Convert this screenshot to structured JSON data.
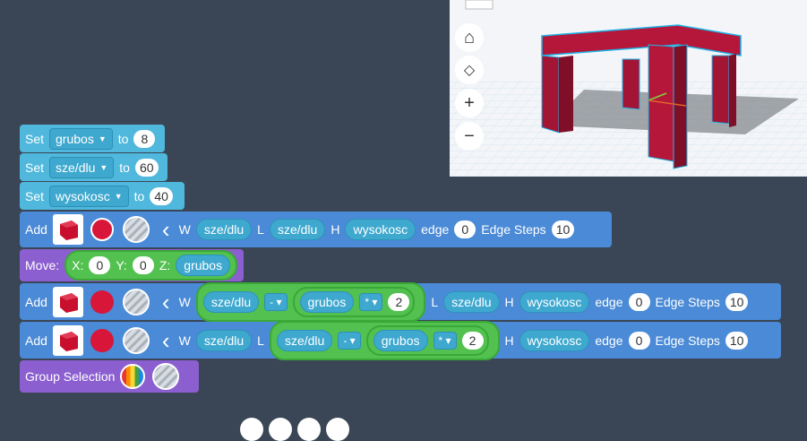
{
  "blocks": {
    "set1": {
      "set": "Set",
      "var": "grubos",
      "to": "to",
      "val": "8"
    },
    "set2": {
      "set": "Set",
      "var": "sze/dlu",
      "to": "to",
      "val": "60"
    },
    "set3": {
      "set": "Set",
      "var": "wysokosc",
      "to": "to",
      "val": "40"
    },
    "add1": {
      "add": "Add",
      "w": "W",
      "wv": "sze/dlu",
      "l": "L",
      "lv": "sze/dlu",
      "h": "H",
      "hv": "wysokosc",
      "edge": "edge",
      "ev": "0",
      "steps": "Edge Steps",
      "sv": "10"
    },
    "move": {
      "label": "Move:",
      "x": "X:",
      "xv": "0",
      "y": "Y:",
      "yv": "0",
      "z": "Z:",
      "zv": "grubos"
    },
    "add2": {
      "add": "Add",
      "w": "W",
      "a": "sze/dlu",
      "op1": "- ▾",
      "b": "grubos",
      "op2": "* ▾",
      "c": "2",
      "l": "L",
      "lv": "sze/dlu",
      "h": "H",
      "hv": "wysokosc",
      "edge": "edge",
      "ev": "0",
      "steps": "Edge Steps",
      "sv": "10"
    },
    "add3": {
      "add": "Add",
      "w": "W",
      "wv": "sze/dlu",
      "l": "L",
      "a": "sze/dlu",
      "op1": "- ▾",
      "b": "grubos",
      "op2": "* ▾",
      "c": "2",
      "h": "H",
      "hv": "wysokosc",
      "edge": "edge",
      "ev": "0",
      "steps": "Edge Steps",
      "sv": "10"
    },
    "group": {
      "label": "Group Selection"
    }
  },
  "viewer": {
    "home": "⌂",
    "fit": "◇",
    "zoom_in": "+",
    "zoom_out": "−"
  },
  "colors": {
    "cyan": "#4fb8dc",
    "blue": "#4a8ad6",
    "purple": "#8c5fd0",
    "green": "#52c14f",
    "red": "#d8163a"
  }
}
